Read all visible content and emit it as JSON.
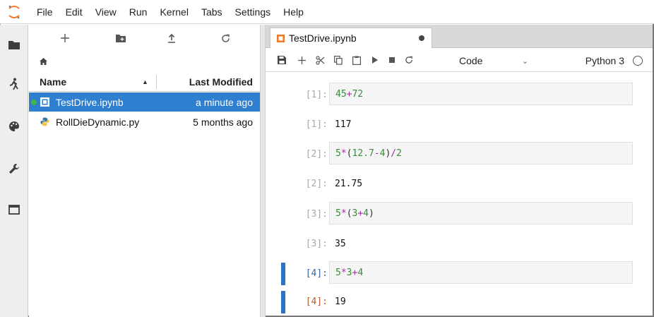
{
  "menubar": {
    "items": [
      "File",
      "Edit",
      "View",
      "Run",
      "Kernel",
      "Tabs",
      "Settings",
      "Help"
    ]
  },
  "rail": {
    "icons": [
      "folder-icon",
      "running-icon",
      "palette-icon",
      "wrench-icon",
      "tabs-icon"
    ]
  },
  "filebrowser": {
    "toolbar": [
      "new-launcher-icon",
      "new-folder-icon",
      "upload-icon",
      "refresh-icon"
    ],
    "columns": {
      "name": "Name",
      "modified": "Last Modified"
    },
    "files": [
      {
        "name": "TestDrive.ipynb",
        "modified": "a minute ago",
        "selected": true,
        "running": true,
        "icon": "notebook-icon"
      },
      {
        "name": "RollDieDynamic.py",
        "modified": "5 months ago",
        "selected": false,
        "running": false,
        "icon": "python-icon"
      }
    ]
  },
  "notebook": {
    "tab_title": "TestDrive.ipynb",
    "cell_type": "Code",
    "kernel": "Python 3",
    "cells": [
      {
        "in_prompt": "[1]:",
        "out_prompt": "[1]:",
        "output": "117",
        "active": false
      },
      {
        "in_prompt": "[2]:",
        "out_prompt": "[2]:",
        "output": "21.75",
        "active": false
      },
      {
        "in_prompt": "[3]:",
        "out_prompt": "[3]:",
        "output": "35",
        "active": false
      },
      {
        "in_prompt": "[4]:",
        "out_prompt": "[4]:",
        "output": "19",
        "active": true
      }
    ],
    "code": {
      "c1": {
        "a": "45",
        "op": "+",
        "b": "72"
      },
      "c2": {
        "a": "5",
        "op1": "*",
        "lp": "(",
        "b": "12.7",
        "op2": "-",
        "c": "4",
        "rp": ")",
        "op3": "/",
        "d": "2"
      },
      "c3": {
        "a": "5",
        "op1": "*",
        "lp": "(",
        "b": "3",
        "op2": "+",
        "c": "4",
        "rp": ")"
      },
      "c4": {
        "a": "5",
        "op1": "*",
        "b": "3",
        "op2": "+",
        "c": "4"
      }
    }
  },
  "colors": {
    "selection": "#2f7fd0",
    "accent": "#2a73c6",
    "number": "#3a8a3a",
    "operator": "#a030a0",
    "kernel_running_dot": "#45b24a"
  }
}
